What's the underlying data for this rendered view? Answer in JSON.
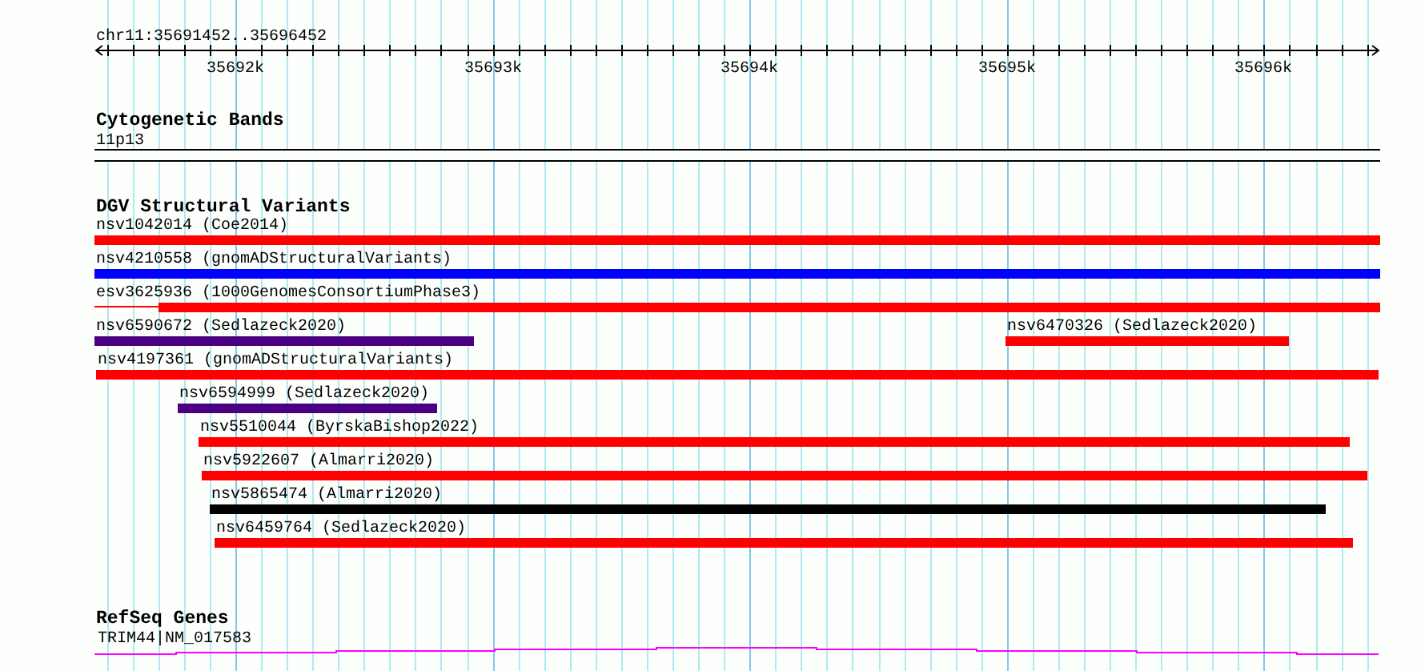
{
  "location": "chr11:35691452..35696452",
  "ruler": {
    "tick_labels": [
      "35692k",
      "35693k",
      "35694k",
      "35695k",
      "35696k"
    ]
  },
  "tracks": [
    {
      "kind": "bands",
      "title": "Cytogenetic Bands",
      "features": [
        {
          "label": "11p13"
        }
      ]
    },
    {
      "kind": "variants",
      "title": "DGV Structural Variants",
      "features": [
        {
          "label": "nsv1042014 (Coe2014)",
          "color": "#ff0000"
        },
        {
          "label": "nsv4210558 (gnomADStructuralVariants)",
          "color": "#0000ff"
        },
        {
          "label": "esv3625936 (1000GenomesConsortiumPhase3)",
          "color": "#ff0000"
        },
        {
          "label": "nsv6590672 (Sedlazeck2020)",
          "color": "#4b0082"
        },
        {
          "label": "nsv6470326 (Sedlazeck2020)",
          "color": "#ff0000"
        },
        {
          "label": "nsv4197361 (gnomADStructuralVariants)",
          "color": "#ff0000"
        },
        {
          "label": "nsv6594999 (Sedlazeck2020)",
          "color": "#4b0082"
        },
        {
          "label": "nsv5510044 (ByrskaBishop2022)",
          "color": "#ff0000"
        },
        {
          "label": "nsv5922607 (Almarri2020)",
          "color": "#ff0000"
        },
        {
          "label": "nsv5865474 (Almarri2020)",
          "color": "#000000"
        },
        {
          "label": "nsv6459764 (Sedlazeck2020)",
          "color": "#ff0000"
        }
      ]
    },
    {
      "kind": "genes",
      "title": "RefSeq Genes",
      "features": [
        {
          "label": "TRIM44|NM_017583"
        }
      ]
    }
  ]
}
